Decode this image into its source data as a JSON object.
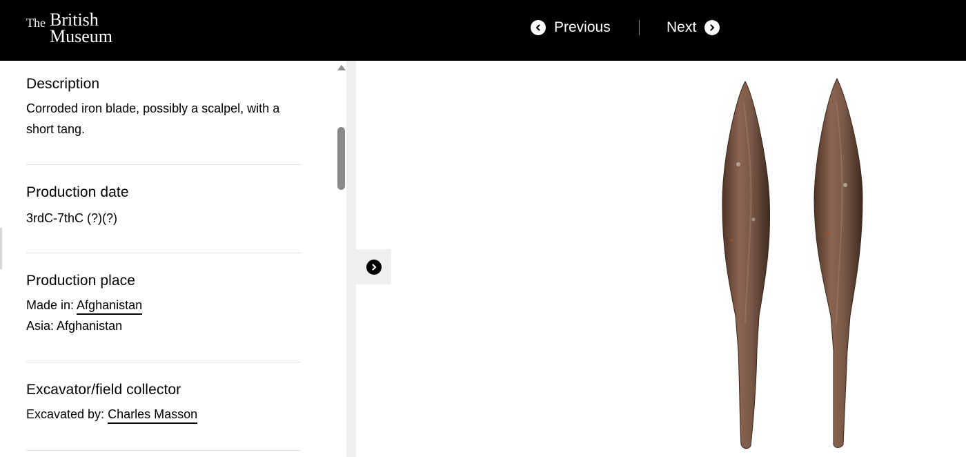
{
  "header": {
    "logo": {
      "the": "The",
      "line1": "British",
      "line2": "Museum"
    },
    "nav": {
      "previous_label": "Previous",
      "next_label": "Next"
    }
  },
  "details": {
    "description": {
      "heading": "Description",
      "text": "Corroded iron blade, possibly a scalpel, with a short tang."
    },
    "production_date": {
      "heading": "Production date",
      "text": "3rdC-7thC (?)(?)"
    },
    "production_place": {
      "heading": "Production place",
      "made_in_label": "Made in: ",
      "made_in_value": "Afghanistan",
      "region_text": "Asia: Afghanistan"
    },
    "excavator": {
      "heading": "Excavator/field collector",
      "label": "Excavated by: ",
      "value": "Charles Masson"
    }
  },
  "icons": {
    "previous": "chevron-left-circle-icon",
    "next": "chevron-right-circle-icon",
    "toggle": "chevron-right-circle-icon"
  },
  "colors": {
    "header_bg": "#000000",
    "header_text": "#ffffff",
    "rust": "#6b4a3a"
  }
}
